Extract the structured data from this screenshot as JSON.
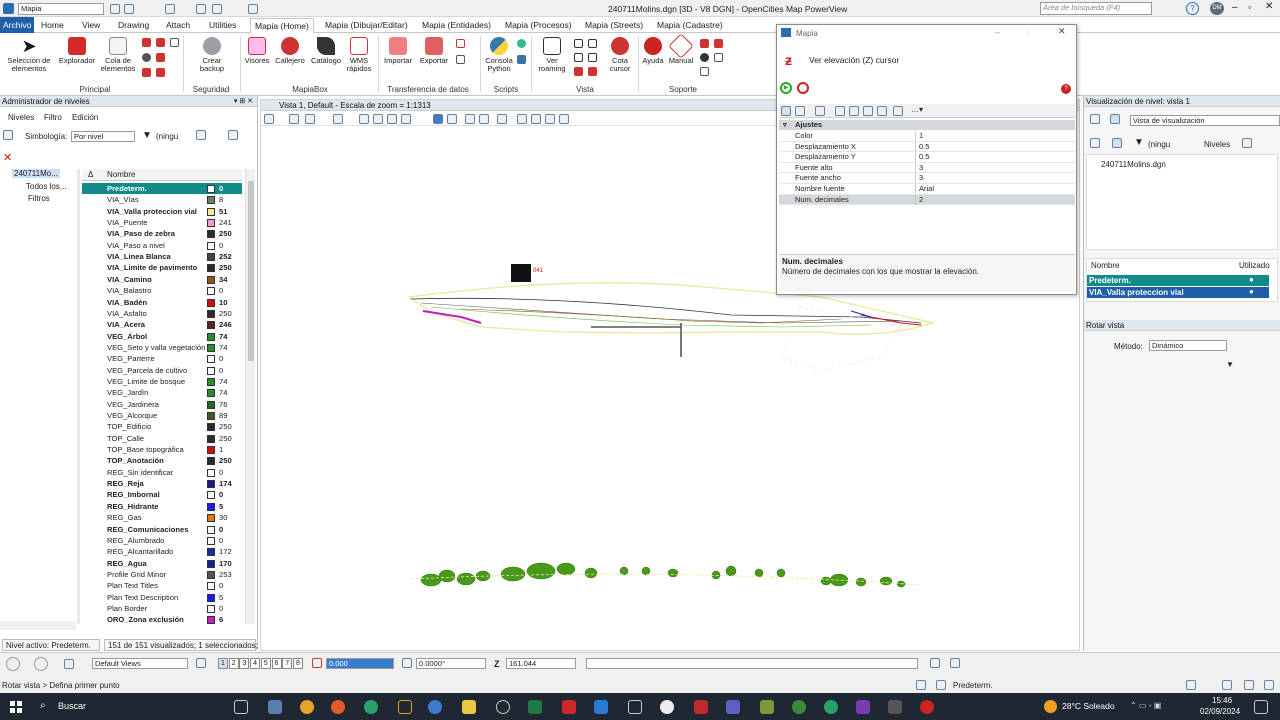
{
  "window": {
    "title": "240711Molins.dgn [3D - V8 DGN] - OpenCities Map PowerView",
    "workflow": "Mapia",
    "search_placeholder": "Área de búsqueda (F4)",
    "user_initials": "DM"
  },
  "ribbon_tabs": [
    "Archivo",
    "Home",
    "View",
    "Drawing",
    "Attach",
    "Utilities",
    "Mapia (Home)",
    "Mapia (Dibujar/Editar)",
    "Mapia (Entidades)",
    "Mapia (Procesos)",
    "Mapia (Streets)",
    "Mapia (Cadastre)"
  ],
  "ribbon": {
    "buttons": {
      "seleccion": "Selección de elementos",
      "explorador": "Explorador",
      "cola": "Cola de elementos",
      "crear_backup": "Crear backup",
      "visores": "Visores",
      "callejero": "Callejero",
      "catalogo": "Catálogo",
      "wms": "WMS rápidos",
      "importar": "Importar",
      "exportar": "Exportar",
      "consola": "Consola Python",
      "ver_roaming": "Ver roaming",
      "cota_cursor": "Cota cursor",
      "ayuda": "Ayuda",
      "manual": "Manual"
    },
    "groups": [
      "Principal",
      "Seguridad",
      "MapiaBox",
      "Transferencia de datos",
      "Scripts",
      "Vista",
      "Soporte"
    ]
  },
  "level_manager": {
    "title": "Administrador de niveles",
    "menu": [
      "Niveles",
      "Filtro",
      "Edición"
    ],
    "symbology_label": "Simbología:",
    "symbology_value": "Por nivel",
    "filter_value": "(ningu",
    "tree": [
      "240711Mo...",
      "Todos los...",
      "Filtros"
    ],
    "header_name": "Nombre",
    "levels": [
      {
        "name": "Predeterm.",
        "num": "0",
        "color": "#ffffff",
        "bold": true,
        "selected": true
      },
      {
        "name": "VIA_Vías",
        "num": "8",
        "color": "#6b7f63",
        "bold": false
      },
      {
        "name": "VIA_Valla proteccion vial",
        "num": "51",
        "color": "#f2f08a",
        "bold": true
      },
      {
        "name": "VIA_Puente",
        "num": "241",
        "color": "#ff9ad0",
        "bold": false
      },
      {
        "name": "VIA_Paso de zebra",
        "num": "250",
        "color": "#2b2b2b",
        "bold": true
      },
      {
        "name": "VIA_Paso a nivel",
        "num": "0",
        "color": "#ffffff",
        "bold": false
      },
      {
        "name": "VIA_Linea Blanca",
        "num": "252",
        "color": "#444444",
        "bold": true
      },
      {
        "name": "VIA_Limite de pavimento",
        "num": "250",
        "color": "#2b2b2b",
        "bold": true
      },
      {
        "name": "VIA_Camino",
        "num": "34",
        "color": "#8a5a1a",
        "bold": true
      },
      {
        "name": "VIA_Balastro",
        "num": "0",
        "color": "#ffffff",
        "bold": false
      },
      {
        "name": "VIA_Badén",
        "num": "10",
        "color": "#d01010",
        "bold": true
      },
      {
        "name": "VIA_Asfalto",
        "num": "250",
        "color": "#2b2b2b",
        "bold": false
      },
      {
        "name": "VIA_Acera",
        "num": "246",
        "color": "#5a2424",
        "bold": true
      },
      {
        "name": "VEG_Árbol",
        "num": "74",
        "color": "#2e8b2e",
        "bold": true
      },
      {
        "name": "VEG_Seto y valla vegetación",
        "num": "74",
        "color": "#2e8b2e",
        "bold": false
      },
      {
        "name": "VEG_Parterre",
        "num": "0",
        "color": "#ffffff",
        "bold": false
      },
      {
        "name": "VEG_Parcela de cultivo",
        "num": "0",
        "color": "#ffffff",
        "bold": false
      },
      {
        "name": "VEG_Limite de bosque",
        "num": "74",
        "color": "#2e8b2e",
        "bold": false
      },
      {
        "name": "VEG_Jardín",
        "num": "74",
        "color": "#2e8b2e",
        "bold": false
      },
      {
        "name": "VEG_Jardinera",
        "num": "76",
        "color": "#1f6b1f",
        "bold": false
      },
      {
        "name": "VEG_Alcorque",
        "num": "89",
        "color": "#3a5a2a",
        "bold": false
      },
      {
        "name": "TOP_Edificio",
        "num": "250",
        "color": "#2b2b2b",
        "bold": false
      },
      {
        "name": "TOP_Calle",
        "num": "250",
        "color": "#2b2b2b",
        "bold": false
      },
      {
        "name": "TOP_Base topográfica",
        "num": "1",
        "color": "#d01010",
        "bold": false
      },
      {
        "name": "TOP_Anotación",
        "num": "250",
        "color": "#2b2b2b",
        "bold": true
      },
      {
        "name": "REG_Sin identificar",
        "num": "0",
        "color": "#ffffff",
        "bold": false
      },
      {
        "name": "REG_Reja",
        "num": "174",
        "color": "#1a1a8a",
        "bold": true
      },
      {
        "name": "REG_Imbornal",
        "num": "0",
        "color": "#ffffff",
        "bold": true
      },
      {
        "name": "REG_Hidrante",
        "num": "5",
        "color": "#1a1aff",
        "bold": true
      },
      {
        "name": "REG_Gas",
        "num": "30",
        "color": "#e07a1a",
        "bold": false
      },
      {
        "name": "REG_Comunicaciones",
        "num": "0",
        "color": "#ffffff",
        "bold": true
      },
      {
        "name": "REG_Alumbrado",
        "num": "0",
        "color": "#ffffff",
        "bold": false
      },
      {
        "name": "REG_Alcantarillado",
        "num": "172",
        "color": "#1a2aa0",
        "bold": false
      },
      {
        "name": "REG_Agua",
        "num": "170",
        "color": "#1a1a9a",
        "bold": true
      },
      {
        "name": "Profile Grid Minor",
        "num": "253",
        "color": "#555555",
        "bold": false
      },
      {
        "name": "Plan Text Titles",
        "num": "0",
        "color": "#ffffff",
        "bold": false
      },
      {
        "name": "Plan Text Description",
        "num": "5",
        "color": "#1a1aff",
        "bold": false
      },
      {
        "name": "Plan Border",
        "num": "0",
        "color": "#ffffff",
        "bold": false
      },
      {
        "name": "ORO_Zona exclusión",
        "num": "6",
        "color": "#c020c0",
        "bold": true
      }
    ]
  },
  "view": {
    "title": "Vista 1, Default - Escala de zoom = 1:1313",
    "cursor_label": "041"
  },
  "dialog": {
    "app": "Mapia",
    "title": "Ver elevación (Z) cursor",
    "section": "Ajustes",
    "properties": [
      {
        "key": "Color",
        "value": "1"
      },
      {
        "key": "Desplazamiento X",
        "value": "0.5"
      },
      {
        "key": "Desplazamiento Y",
        "value": "0.5"
      },
      {
        "key": "Fuente alto",
        "value": "3"
      },
      {
        "key": "Fuente ancho",
        "value": "3"
      },
      {
        "key": "Nombre fuente",
        "value": "Arial"
      },
      {
        "key": "Num. decimales",
        "value": "2"
      }
    ],
    "help_title": "Num. decimales",
    "help_text": "Número de decimales con los que mostrar la elevación."
  },
  "level_display": {
    "title": "Visualización de nivel: vista 1",
    "view_mode": "Vista de visualización",
    "filter_value": "(ningu",
    "levels_button": "Niveles",
    "file": "240711Molins.dgn",
    "col_name": "Nombre",
    "col_used": "Utilizado",
    "rows": [
      "Predeterm.",
      "VIA_Valla proteccion vial"
    ]
  },
  "rotate_view": {
    "title": "Rotar vista",
    "method_label": "Método:",
    "method_value": "Dinámico"
  },
  "status": {
    "active_level": "Nivel activo: Predeterm.",
    "visible_count": "151 de 151 visualizados; 1 seleccionados;",
    "views_dropdown": "Default Views",
    "view_numbers": [
      "1",
      "2",
      "3",
      "4",
      "5",
      "6",
      "7",
      "8"
    ],
    "x_field": "0.000",
    "angle_field": "0.0000°",
    "z_label": "Z",
    "z_value": "161.044",
    "prompt": "Rotar vista > Defina primer punto",
    "level_right": "Predeterm."
  },
  "taskbar": {
    "search": "Buscar",
    "weather": "28°C Soleado",
    "time": "15:46",
    "date": "02/09/2024"
  },
  "colors": {
    "selected_row": "#138a8a",
    "file_tab": "#1f5fa8",
    "taskbar": "#1f2733",
    "vegetation": "#4a9a1a"
  }
}
